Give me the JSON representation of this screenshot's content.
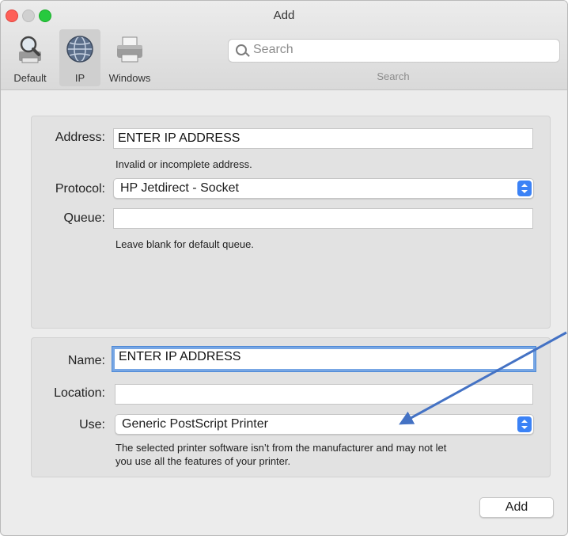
{
  "window": {
    "title": "Add"
  },
  "toolbar": {
    "items": [
      {
        "label": "Default",
        "icon": "magnifier-printer-icon"
      },
      {
        "label": "IP",
        "icon": "globe-icon",
        "selected": true
      },
      {
        "label": "Windows",
        "icon": "printer-icon"
      }
    ],
    "search_placeholder": "Search",
    "search_caption": "Search"
  },
  "connection": {
    "address_label": "Address:",
    "address_value": "ENTER IP ADDRESS",
    "address_hint": "Invalid or incomplete address.",
    "protocol_label": "Protocol:",
    "protocol_value": "HP Jetdirect - Socket",
    "queue_label": "Queue:",
    "queue_value": "",
    "queue_hint": "Leave blank for default queue."
  },
  "printer": {
    "name_label": "Name:",
    "name_value": "ENTER IP ADDRESS",
    "location_label": "Location:",
    "location_value": "",
    "use_label": "Use:",
    "use_value": "Generic PostScript Printer",
    "use_hint_line1": "The selected printer software isn’t from the manufacturer and may not let",
    "use_hint_line2": "you use all the features of your printer."
  },
  "footer": {
    "add_label": "Add"
  },
  "colors": {
    "accent": "#3b82f6",
    "annotation_arrow": "#4472c4",
    "focus_ring": "#77a6e4"
  }
}
